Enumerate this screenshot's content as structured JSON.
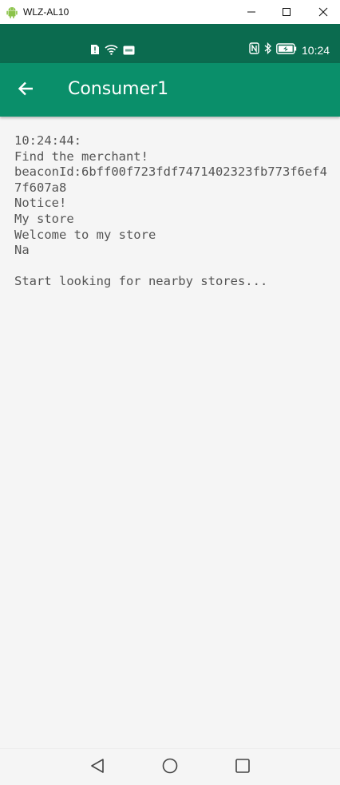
{
  "window": {
    "title": "WLZ-AL10",
    "app_icon": "android-icon",
    "controls": [
      "minimize-icon",
      "maximize-icon",
      "close-icon"
    ]
  },
  "status_bar": {
    "time": "10:24",
    "left_icons": [
      "alert-icon",
      "wifi-icon",
      "nfc-badge-icon"
    ],
    "right_icons": [
      "nfc-icon",
      "bluetooth-icon",
      "battery-icon"
    ]
  },
  "app_bar": {
    "title": "Consumer1",
    "back_icon": "arrow-back-icon"
  },
  "log": {
    "lines": [
      "10:24:44:",
      "Find the merchant!",
      "beaconId:6bff00f723fdf7471402323fb773f6ef47f607a8",
      "Notice!",
      "My store",
      "Welcome to my store",
      "Na",
      "",
      "Start looking for nearby stores..."
    ]
  },
  "nav_bar": {
    "items": [
      "nav-back-icon",
      "nav-home-icon",
      "nav-recent-icon"
    ]
  },
  "colors": {
    "status_bar": "#0b6b4f",
    "app_bar": "#0a8f6a",
    "content_bg": "#f5f5f5",
    "log_text": "#555555"
  }
}
